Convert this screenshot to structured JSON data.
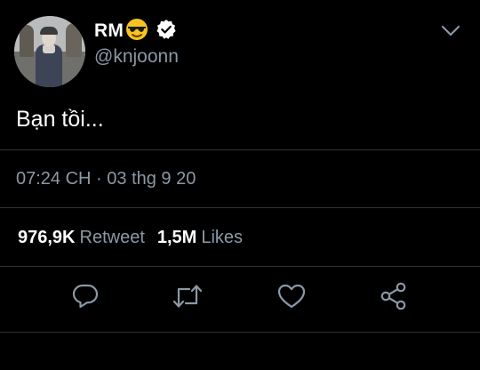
{
  "author": {
    "display_name": "RM",
    "name_emoji": "smiling-face-with-sunglasses-emoji",
    "verified_icon": "verified-badge-icon",
    "handle": "@knjoonn"
  },
  "tweet": {
    "text": "Bạn tồi...",
    "timestamp": "07:24 CH · 03 thg 9 20"
  },
  "stats": {
    "retweets_count": "976,9K",
    "retweets_label": "Retweet",
    "likes_count": "1,5M",
    "likes_label": "Likes"
  },
  "actions": {
    "reply_icon": "reply-icon",
    "retweet_icon": "retweet-icon",
    "like_icon": "heart-icon",
    "share_icon": "share-icon"
  },
  "colors": {
    "background": "#000000",
    "primary_text": "#ffffff",
    "secondary_text": "#8b98a5",
    "divider": "#2f3336",
    "icon": "#8b98a5"
  }
}
